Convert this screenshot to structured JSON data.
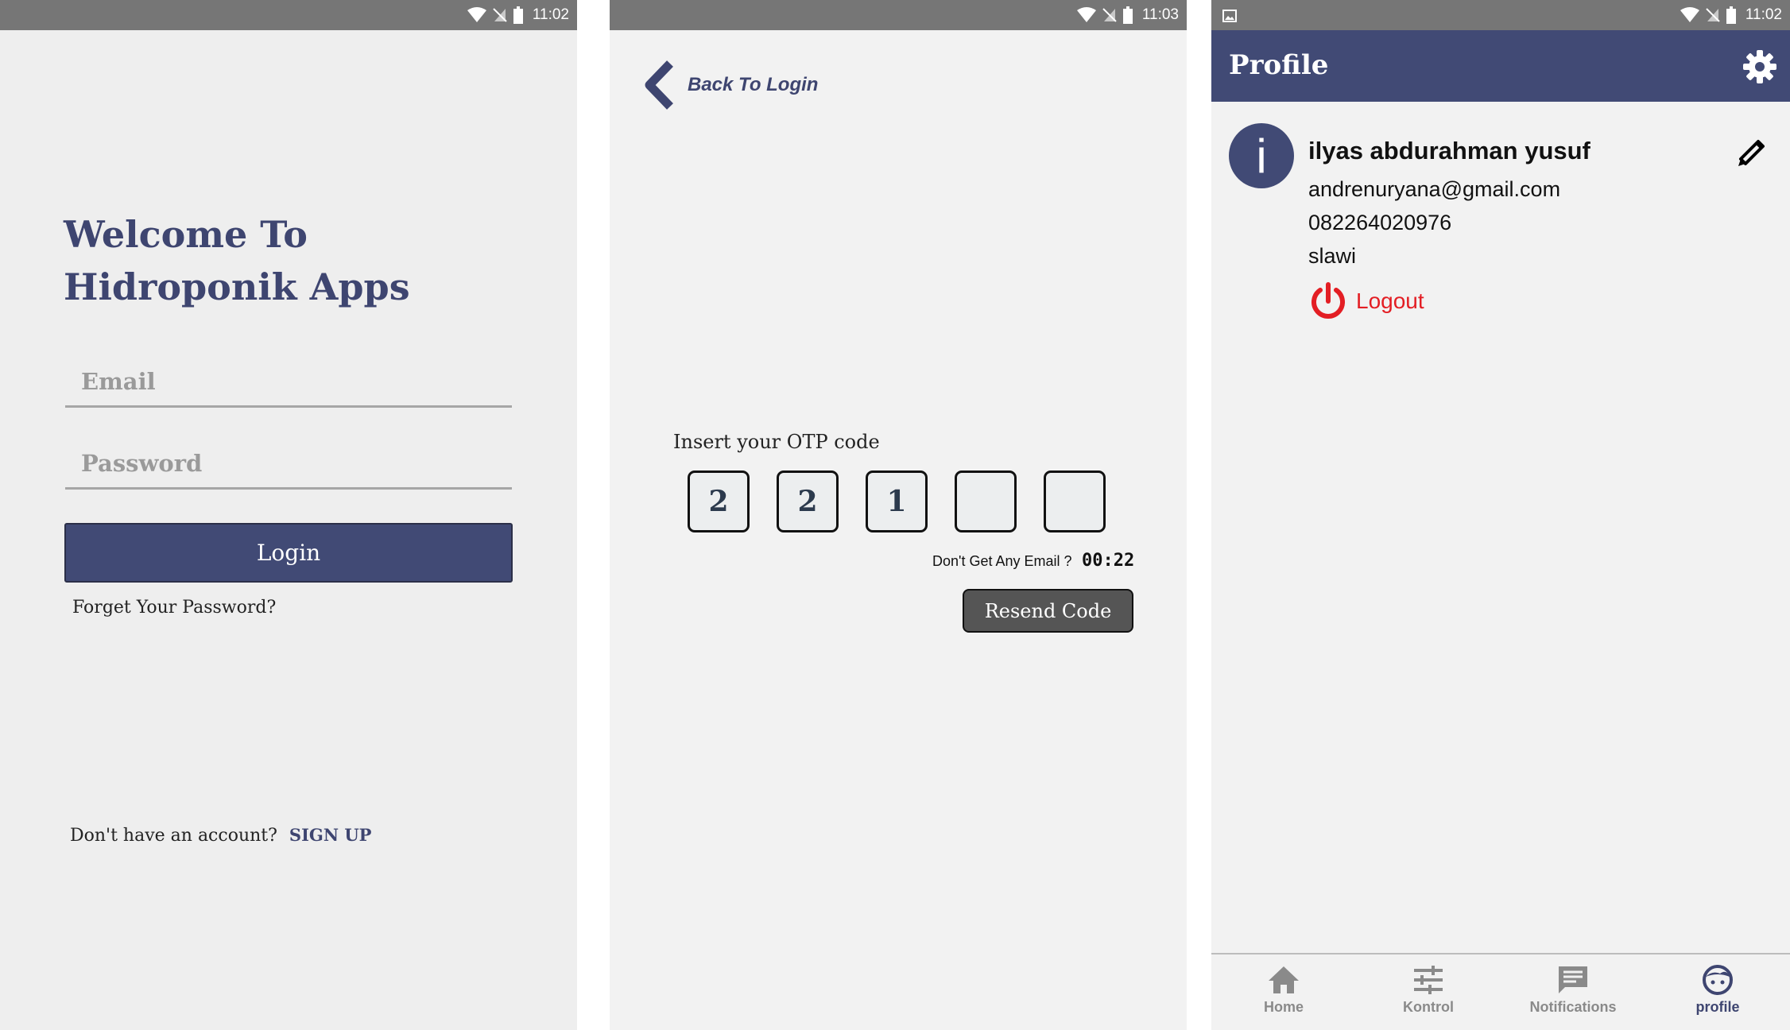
{
  "screens": {
    "login": {
      "status_time": "11:02",
      "welcome_line1": "Welcome To",
      "welcome_line2": "Hidroponik Apps",
      "email_placeholder": "Email",
      "password_placeholder": "Password",
      "login_label": "Login",
      "forget_label": "Forget Your Password?",
      "no_account_label": "Don't have an account?",
      "signup_label": "SIGN UP"
    },
    "otp": {
      "status_time": "11:03",
      "back_label": "Back To Login",
      "otp_prompt": "Insert your OTP code",
      "otp_digits": [
        "2",
        "2",
        "1",
        "",
        ""
      ],
      "no_email_label": "Don't Get Any Email ?",
      "timer": "00:22",
      "resend_label": "Resend Code"
    },
    "profile": {
      "status_time": "11:02",
      "title": "Profile",
      "avatar_letter": "i",
      "name": "ilyas abdurahman yusuf",
      "email": "andrenuryana@gmail.com",
      "phone": "082264020976",
      "city": "slawi",
      "logout_label": "Logout",
      "nav": [
        {
          "label": "Home",
          "icon": "home-icon",
          "active": false
        },
        {
          "label": "Kontrol",
          "icon": "sliders-icon",
          "active": false
        },
        {
          "label": "Notifications",
          "icon": "chat-icon",
          "active": false
        },
        {
          "label": "profile",
          "icon": "face-icon",
          "active": true
        }
      ]
    }
  },
  "colors": {
    "primary": "#414a75",
    "status_bar": "#767676",
    "logout_red": "#e31e24",
    "resend_gray": "#555555"
  }
}
